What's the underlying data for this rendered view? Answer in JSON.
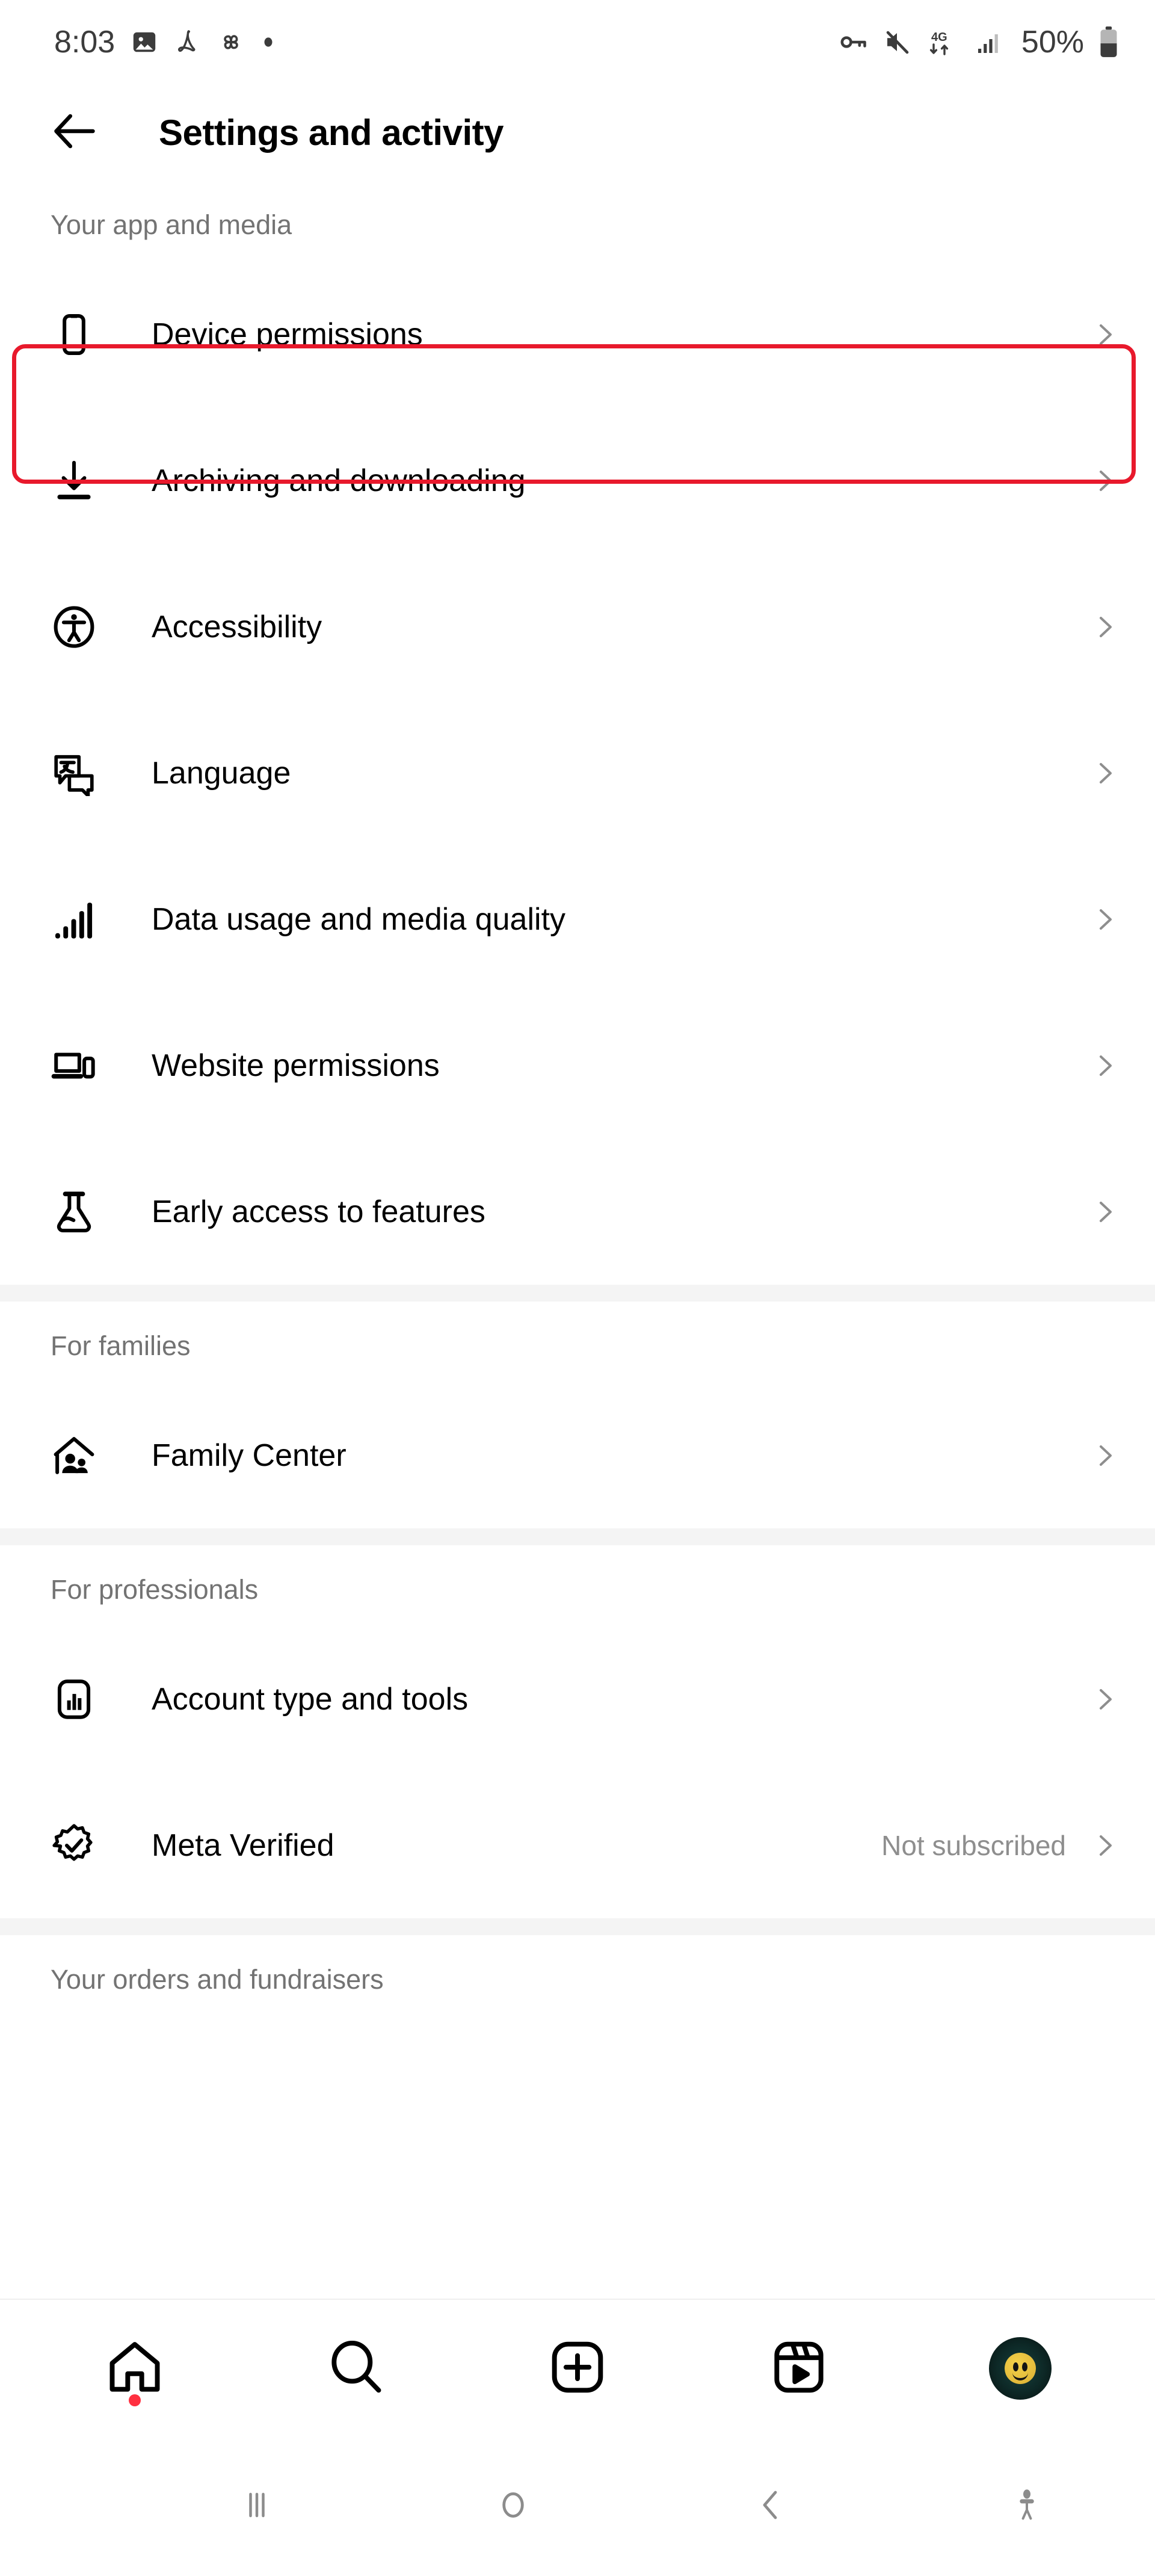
{
  "status_bar": {
    "time": "8:03",
    "battery_percent": "50%",
    "left_icons": [
      "photo-icon",
      "adobe-acrobat-icon",
      "pinwheel-icon",
      "dot-icon"
    ],
    "right_icons": [
      "vpn-key-icon",
      "volume-mute-icon",
      "network-4g-icon",
      "signal-bars-icon",
      "battery-icon"
    ],
    "network_label": "4G"
  },
  "header": {
    "back_icon": "arrow-left-icon",
    "title": "Settings and activity"
  },
  "sections": [
    {
      "label": "Your app and media",
      "rows": [
        {
          "icon": "phone-icon",
          "label": "Device permissions",
          "value": "",
          "highlighted": true
        },
        {
          "icon": "download-icon",
          "label": "Archiving and downloading",
          "value": ""
        },
        {
          "icon": "accessibility-icon",
          "label": "Accessibility",
          "value": ""
        },
        {
          "icon": "translate-icon",
          "label": "Language",
          "value": ""
        },
        {
          "icon": "signal-bars-icon",
          "label": "Data usage and media quality",
          "value": ""
        },
        {
          "icon": "devices-icon",
          "label": "Website permissions",
          "value": ""
        },
        {
          "icon": "flask-icon",
          "label": "Early access to features",
          "value": ""
        }
      ]
    },
    {
      "label": "For families",
      "rows": [
        {
          "icon": "family-house-icon",
          "label": "Family Center",
          "value": ""
        }
      ]
    },
    {
      "label": "For professionals",
      "rows": [
        {
          "icon": "bar-chart-icon",
          "label": "Account type and tools",
          "value": ""
        },
        {
          "icon": "meta-verified-badge-icon",
          "label": "Meta Verified",
          "value": "Not subscribed"
        }
      ]
    },
    {
      "label": "Your orders and fundraisers",
      "rows": []
    }
  ],
  "bottom_nav": [
    {
      "icon": "home-icon",
      "badge": true
    },
    {
      "icon": "search-icon",
      "badge": false
    },
    {
      "icon": "create-post-icon",
      "badge": false
    },
    {
      "icon": "reels-icon",
      "badge": false
    },
    {
      "icon": "profile-avatar",
      "badge": false
    }
  ],
  "android_nav": [
    {
      "icon": "recents-icon"
    },
    {
      "icon": "home-circle-icon"
    },
    {
      "icon": "back-chevron-icon"
    },
    {
      "icon": "accessibility-person-icon"
    }
  ],
  "colors": {
    "highlight_red": "#e8192c",
    "text_primary": "#000000",
    "text_secondary": "#737373",
    "chevron_gray": "#8e8e8e",
    "divider_band": "#f4f4f4",
    "badge_red": "#ff3040"
  }
}
